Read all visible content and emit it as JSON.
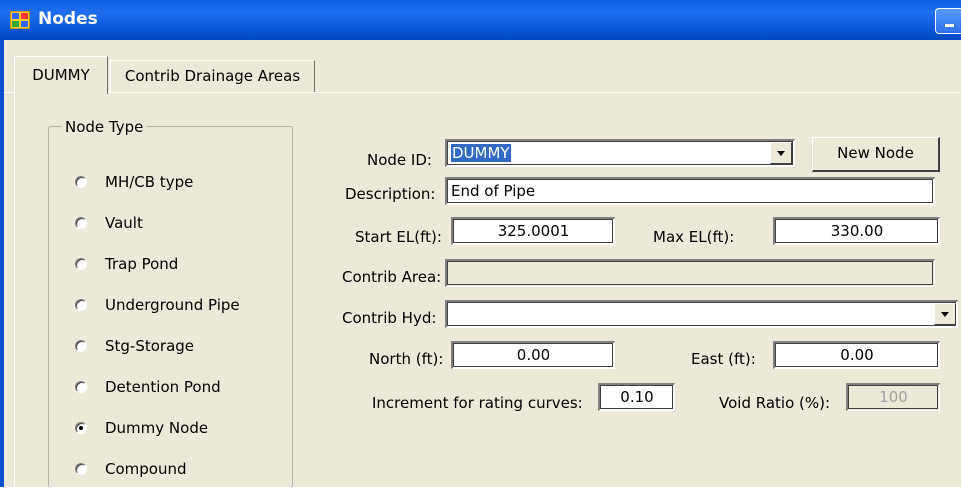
{
  "window": {
    "title": "Nodes"
  },
  "tabs": [
    {
      "label": "DUMMY"
    },
    {
      "label": "Contrib Drainage Areas"
    }
  ],
  "node_type": {
    "label": "Node Type",
    "options": [
      {
        "label": "MH/CB type",
        "selected": false
      },
      {
        "label": "Vault",
        "selected": false
      },
      {
        "label": "Trap Pond",
        "selected": false
      },
      {
        "label": "Underground Pipe",
        "selected": false
      },
      {
        "label": "Stg-Storage",
        "selected": false
      },
      {
        "label": "Detention Pond",
        "selected": false
      },
      {
        "label": "Dummy Node",
        "selected": true
      },
      {
        "label": "Compound",
        "selected": false
      }
    ]
  },
  "form": {
    "node_id_label": "Node ID:",
    "node_id_value": "DUMMY",
    "new_node_label": "New Node",
    "description_label": "Description:",
    "description_value": "End of Pipe",
    "start_el_label": "Start EL(ft):",
    "start_el_value": "325.0001",
    "max_el_label": "Max EL(ft):",
    "max_el_value": "330.00",
    "contrib_area_label": "Contrib Area:",
    "contrib_area_value": "",
    "contrib_hyd_label": "Contrib Hyd:",
    "contrib_hyd_value": "",
    "north_label": "North (ft):",
    "north_value": "0.00",
    "east_label": "East (ft):",
    "east_value": "0.00",
    "increment_label": "Increment for rating curves:",
    "increment_value": "0.10",
    "void_ratio_label": "Void Ratio (%):",
    "void_ratio_value": "100"
  },
  "colors": {
    "titlebar": "#0a5fdc",
    "client": "#ece9d8",
    "selection": "#316ac5"
  }
}
